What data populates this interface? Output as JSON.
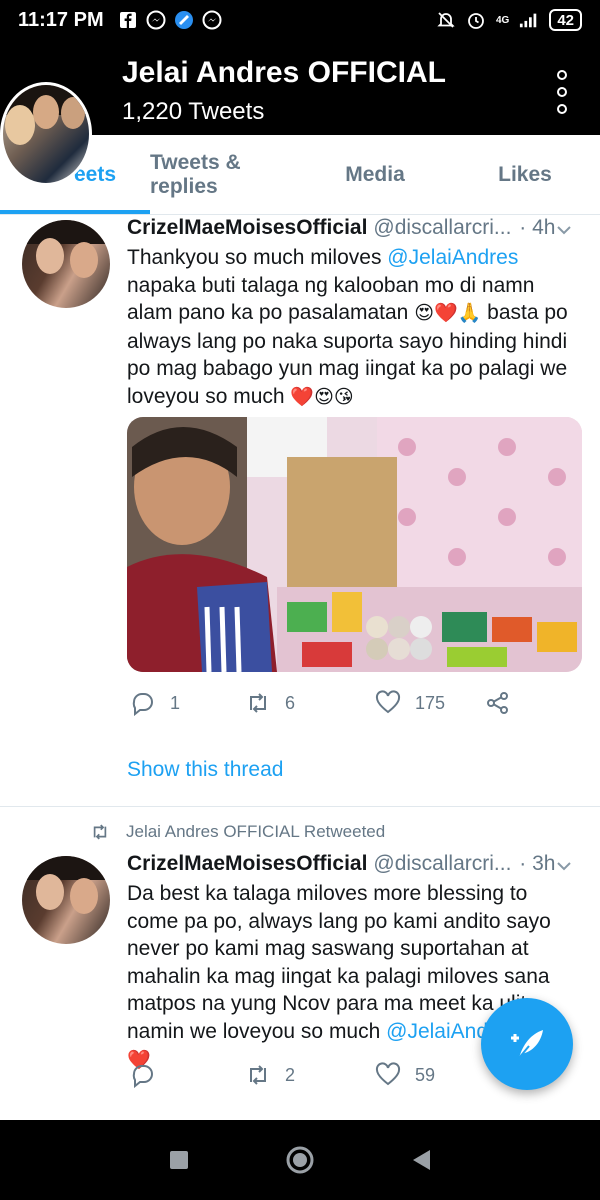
{
  "status_bar": {
    "time": "11:17 PM",
    "network": "4G",
    "battery": "42"
  },
  "header": {
    "title": "Jelai Andres OFFICIAL",
    "subtitle": "1,220 Tweets"
  },
  "tabs": [
    {
      "label": "Tweets",
      "visible_label": "eets"
    },
    {
      "label": "Tweets & replies"
    },
    {
      "label": "Media"
    },
    {
      "label": "Likes"
    }
  ],
  "tweets": [
    {
      "name": "CrizelMaeMoisesOfficial",
      "handle": "@discallarcri...",
      "time": "· 4h",
      "body_1": "Thankyou so much miloves ",
      "mention": "@JelaiAndres",
      "body_2": " napaka buti talaga ng kalooban mo di namn alam pano ka po pasalamatan ",
      "emoji_1": "😍❤️🙏",
      "body_3": " basta po always lang po naka suporta sayo hinding hindi po mag babago yun mag iingat ka po palagi we loveyou so much ",
      "emoji_2": "❤️😍😘",
      "replies": "1",
      "retweets": "6",
      "likes": "175",
      "show_thread": "Show this thread"
    },
    {
      "retweet_label": "Jelai Andres OFFICIAL Retweeted",
      "name": "CrizelMaeMoisesOfficial",
      "handle": "@discallarcri...",
      "time": "· 3h",
      "body_1": "Da best ka talaga miloves more blessing to come pa po, always lang po kami andito sayo never po kami mag saswang suportahan at mahalin ka mag iingat ka palagi miloves sana matpos na yung Ncov para ma meet ka ulit namin we loveyou so much ",
      "mention": "@JelaiAndres",
      "emoji_1": " 😍😍❤️",
      "replies": "",
      "retweets": "2",
      "likes": "59"
    }
  ],
  "colors": {
    "accent": "#1da1f2",
    "text": "#14171a",
    "muted": "#657786",
    "header_bg": "#000000"
  }
}
